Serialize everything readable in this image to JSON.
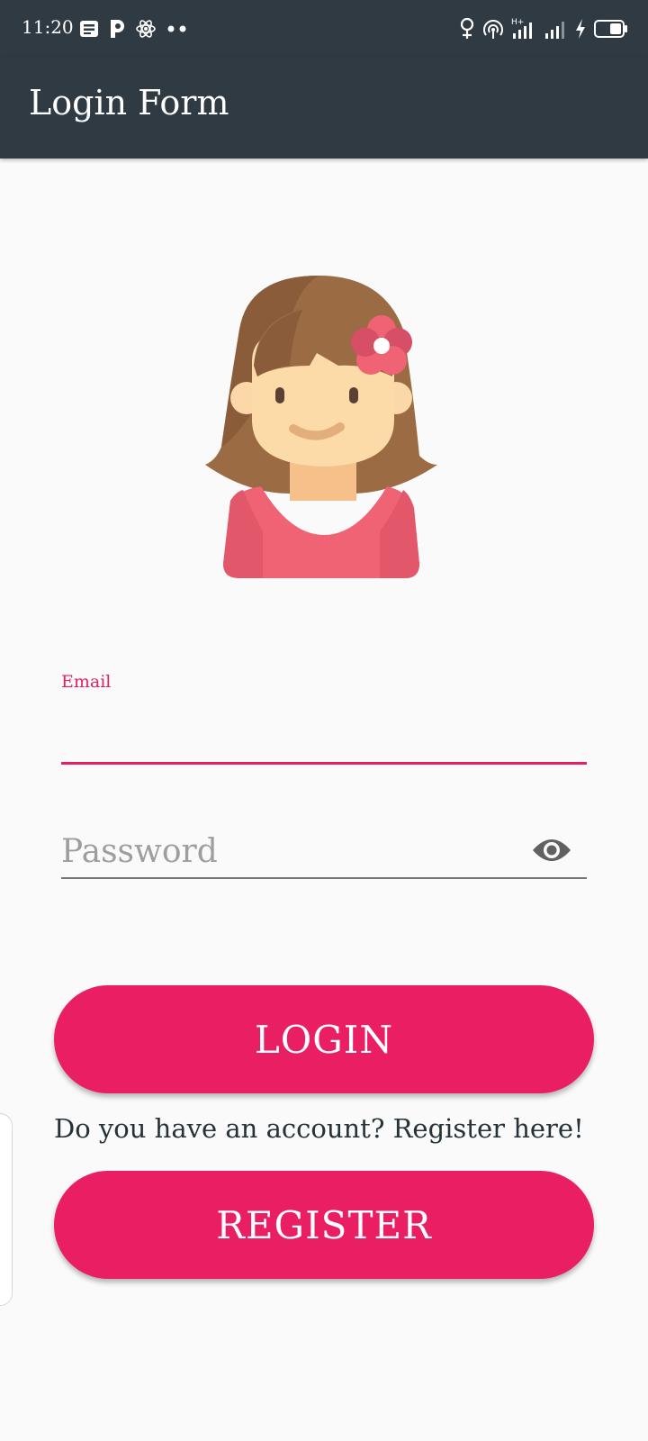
{
  "status_bar": {
    "time": "11:20",
    "left_icons": [
      "news-icon",
      "p-app-icon",
      "atom-icon",
      "more-dots-icon"
    ],
    "right_icons": [
      "location-pin-icon",
      "hotspot-icon",
      "signal-h-plus-icon",
      "signal-icon",
      "charging-bolt-icon",
      "battery-icon"
    ]
  },
  "app_bar": {
    "title": "Login Form"
  },
  "form": {
    "email_label": "Email",
    "email_value": "",
    "password_placeholder": "Password",
    "password_value": "",
    "eye_icon": "eye-icon"
  },
  "actions": {
    "login_label": "LOGIN",
    "register_prompt": "Do you have an account? Register here!",
    "register_label": "REGISTER"
  },
  "colors": {
    "app_bar": "#2f3a42",
    "accent": "#e91e63",
    "background": "#fafafa",
    "text_dark": "#263238",
    "hint": "#9e9e9e"
  }
}
